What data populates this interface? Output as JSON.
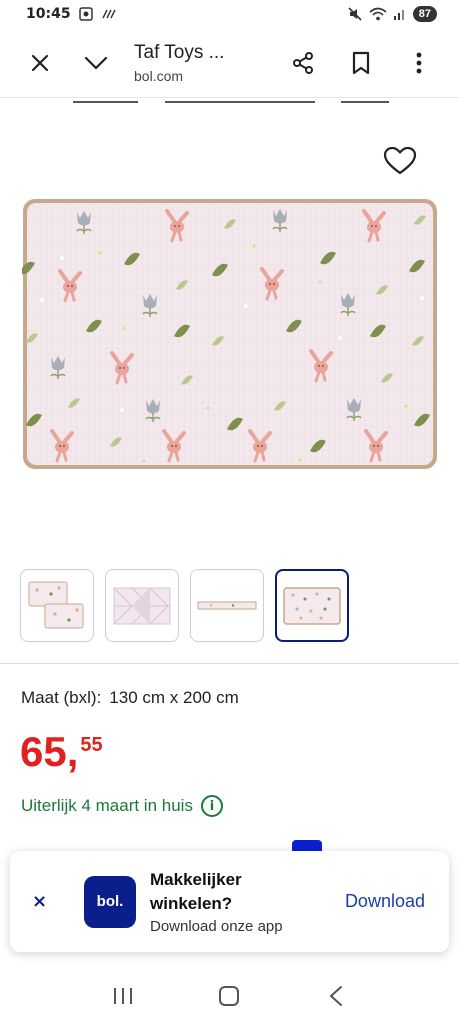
{
  "status_bar": {
    "time": "10:45",
    "battery": "87"
  },
  "toolbar": {
    "title": "Taf Toys ...",
    "domain": "bol.com"
  },
  "product": {
    "size_label": "Maat (bxl):",
    "size_value": "130 cm x 200 cm",
    "price_whole": "65,",
    "price_cents": "55",
    "delivery": "Uiterlijk 4 maart in huis",
    "thumbnail_count": 4,
    "active_thumbnail": 4
  },
  "app_banner": {
    "close": "×",
    "logo": "bol.",
    "heading_line1": "Makkelijker",
    "heading_line2": "winkelen?",
    "subtext": "Download onze app",
    "download": "Download"
  },
  "colors": {
    "price": "#e0211d",
    "delivery": "#1a7a3a",
    "brand": "#0a1f8c"
  }
}
